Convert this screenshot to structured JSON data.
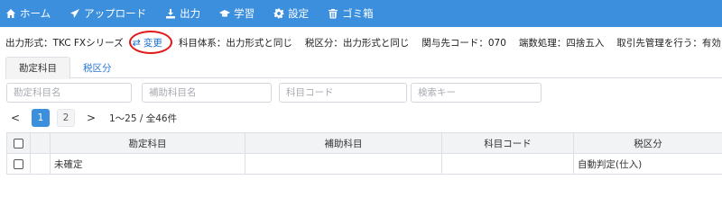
{
  "nav": {
    "items": [
      {
        "label": "ホーム",
        "icon": "home-icon"
      },
      {
        "label": "アップロード",
        "icon": "send-icon"
      },
      {
        "label": "出力",
        "icon": "output-icon"
      },
      {
        "label": "学習",
        "icon": "graduation-cap-icon"
      },
      {
        "label": "設定",
        "icon": "gear-icon"
      },
      {
        "label": "ゴミ箱",
        "icon": "trash-icon"
      }
    ],
    "color": "#3b8fdc"
  },
  "settings": {
    "output_format": "出力形式：TKC FXシリーズ",
    "change_label": "変更",
    "change_icon": "swap-icon",
    "subject_system": "科目体系：出力形式と同じ",
    "tax_category": "税区分：出力形式と同じ",
    "related_code": "関与先コード：070",
    "rounding": "端数処理：四捨五入",
    "partner_mgmt": "取引先管理を行う：有効"
  },
  "tabs": [
    {
      "label": "勘定科目",
      "active": true
    },
    {
      "label": "税区分",
      "active": false
    }
  ],
  "filters": {
    "account": {
      "placeholder": "勘定科目名",
      "value": ""
    },
    "sub_account": {
      "placeholder": "補助科目名",
      "value": ""
    },
    "code": {
      "placeholder": "科目コード",
      "value": ""
    },
    "search_key": {
      "placeholder": "検索キー",
      "value": ""
    }
  },
  "pagination": {
    "prev": "<",
    "pages": [
      "1",
      "2"
    ],
    "current": "1",
    "next": ">",
    "summary": "1〜25 / 全46件"
  },
  "table": {
    "headers": [
      "勘定科目",
      "補助科目",
      "科目コード",
      "税区分"
    ],
    "rows": [
      {
        "account": "未確定",
        "sub_account": "",
        "code": "",
        "tax": "自動判定(仕入)"
      }
    ]
  }
}
